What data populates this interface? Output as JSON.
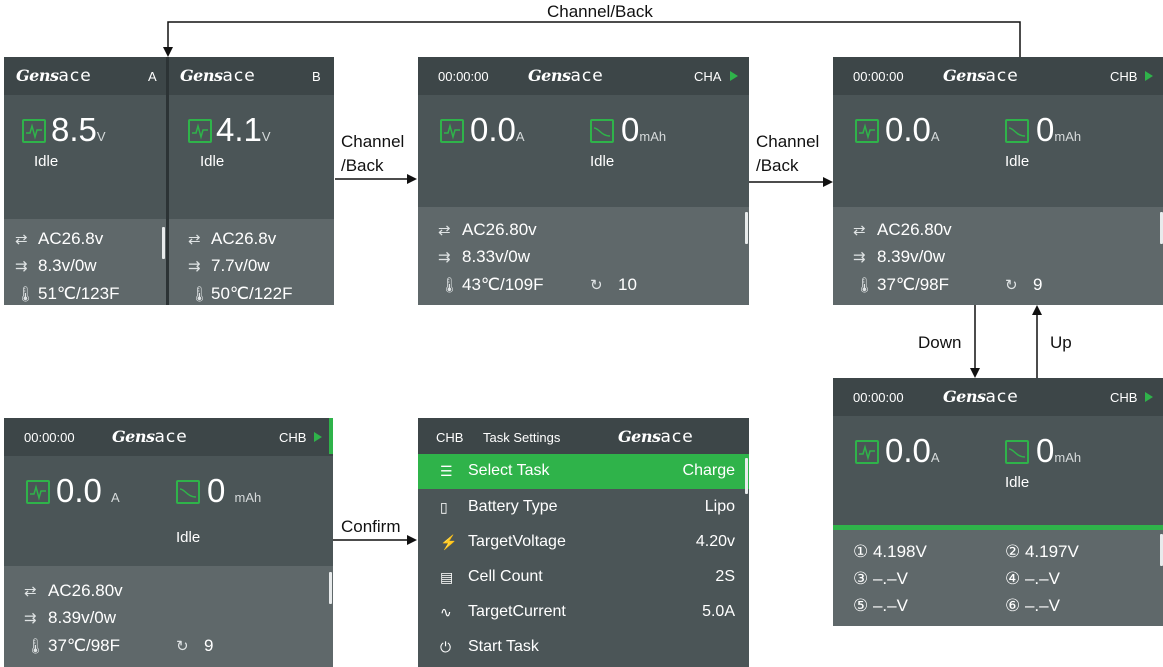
{
  "labels": {
    "channel_back_top": "Channel/Back",
    "channel_1": "Channel",
    "back_1": "/Back",
    "channel_2": "Channel",
    "back_2": "/Back",
    "down": "Down",
    "up": "Up",
    "confirm": "Confirm"
  },
  "logo": {
    "part1": "Gens",
    "part2": "ace"
  },
  "dual": {
    "a": {
      "tag": "A",
      "value": "8.5",
      "unit": "V",
      "status": "Idle",
      "input": "AC26.8v",
      "output": "8.3v/0w",
      "temp": "51℃/123F"
    },
    "b": {
      "tag": "B",
      "value": "4.1",
      "unit": "V",
      "status": "Idle",
      "input": "AC26.8v",
      "output": "7.7v/0w",
      "temp": "50℃/122F"
    }
  },
  "cha": {
    "time": "00:00:00",
    "channel": "CHA",
    "current": "0.0",
    "current_unit": "A",
    "capacity": "0",
    "capacity_unit": "mAh",
    "status": "Idle",
    "input": "AC26.80v",
    "output": "8.33v/0w",
    "temp": "43℃/109F",
    "cycles": "10"
  },
  "chb": {
    "time": "00:00:00",
    "channel": "CHB",
    "current": "0.0",
    "current_unit": "A",
    "capacity": "0",
    "capacity_unit": "mAh",
    "status": "Idle",
    "input": "AC26.80v",
    "output": "8.39v/0w",
    "temp": "37℃/98F",
    "cycles": "9"
  },
  "cells": {
    "time": "00:00:00",
    "channel": "CHB",
    "current": "0.0",
    "current_unit": "A",
    "capacity": "0",
    "capacity_unit": "mAh",
    "status": "Idle",
    "c1": "① 4.198V",
    "c2": "② 4.197V",
    "c3": "③ –.–V",
    "c4": "④ –.–V",
    "c5": "⑤ –.–V",
    "c6": "⑥ –.–V"
  },
  "chb_left": {
    "time": "00:00:00",
    "channel": "CHB",
    "current": "0.0",
    "current_unit": "A",
    "capacity": "0",
    "capacity_unit": "mAh",
    "status": "Idle",
    "input": "AC26.80v",
    "output": "8.39v/0w",
    "temp": "37℃/98F",
    "cycles": "9"
  },
  "task": {
    "channel": "CHB",
    "title": "Task Settings",
    "items": [
      {
        "label": "Select Task",
        "value": "Charge"
      },
      {
        "label": "Battery Type",
        "value": "Lipo"
      },
      {
        "label": "TargetVoltage",
        "value": "4.20v"
      },
      {
        "label": "Cell Count",
        "value": "2S"
      },
      {
        "label": "TargetCurrent",
        "value": "5.0A"
      },
      {
        "label": "Start Task",
        "value": ""
      }
    ]
  },
  "colors": {
    "accent": "#2fb34a",
    "screen": "#4b5557",
    "header": "#3d4648",
    "lower": "#5f686a"
  },
  "icons": [
    "wave-icon",
    "discharge-icon",
    "input-icon",
    "output-icon",
    "thermometer-icon",
    "cycle-icon",
    "list-icon",
    "battery-icon",
    "voltage-icon",
    "cell-icon",
    "current-icon",
    "power-icon"
  ]
}
